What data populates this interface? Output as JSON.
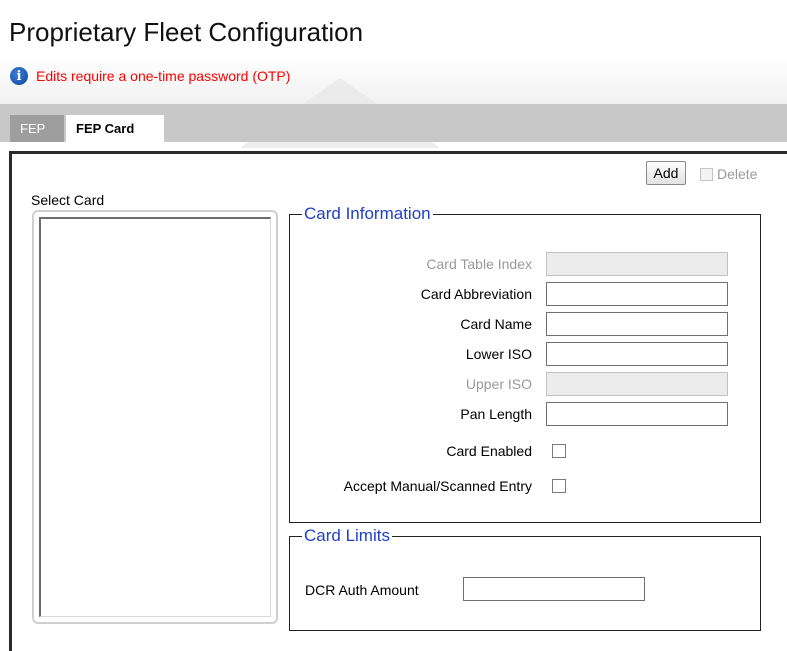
{
  "page": {
    "title": "Proprietary Fleet Configuration",
    "otp_notice": "Edits require a one-time password (OTP)",
    "info_icon": "info-icon"
  },
  "tabs": [
    {
      "label": "FEP",
      "active": false
    },
    {
      "label": "FEP Card",
      "active": true
    }
  ],
  "toolbar": {
    "add_label": "Add",
    "delete_label": "Delete",
    "delete_enabled": false
  },
  "select_card": {
    "label": "Select Card",
    "items": []
  },
  "card_information": {
    "legend": "Card Information",
    "fields": {
      "card_table_index": {
        "label": "Card Table Index",
        "value": "",
        "enabled": false
      },
      "card_abbreviation": {
        "label": "Card Abbreviation",
        "value": "",
        "enabled": true
      },
      "card_name": {
        "label": "Card Name",
        "value": "",
        "enabled": true
      },
      "lower_iso": {
        "label": "Lower ISO",
        "value": "",
        "enabled": true
      },
      "upper_iso": {
        "label": "Upper ISO",
        "value": "",
        "enabled": false
      },
      "pan_length": {
        "label": "Pan Length",
        "value": "",
        "enabled": true
      }
    },
    "checkboxes": {
      "card_enabled": {
        "label": "Card Enabled",
        "checked": false
      },
      "accept_manual": {
        "label": "Accept Manual/Scanned Entry",
        "checked": false
      }
    }
  },
  "card_limits": {
    "legend": "Card Limits",
    "dcr_auth_amount": {
      "label": "DCR Auth Amount",
      "value": ""
    }
  },
  "colors": {
    "title": "#111111",
    "otp_notice": "#ff0000",
    "legend": "#1e40c8",
    "tab_bar": "#c8c8c8",
    "tab_inactive": "#9e9e9e",
    "disabled_text": "#9a9a9a"
  }
}
